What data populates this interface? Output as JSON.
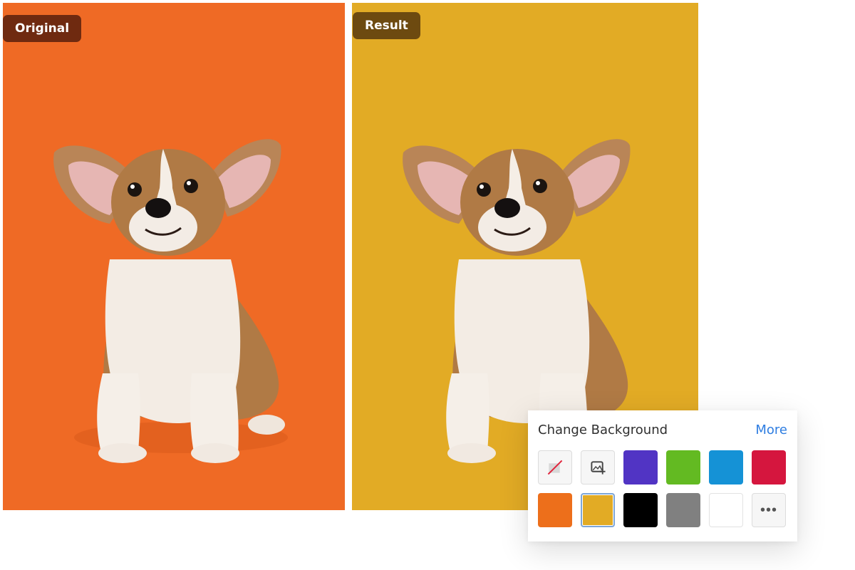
{
  "original": {
    "label": "Original",
    "background_color": "#ef6a25"
  },
  "result": {
    "label": "Result",
    "background_color": "#e2ab25"
  },
  "change_background": {
    "title": "Change Background",
    "more_label": "More",
    "row1": [
      {
        "kind": "transparent",
        "icon": "no-background-icon"
      },
      {
        "kind": "image",
        "icon": "add-image-icon"
      },
      {
        "kind": "color",
        "color": "#5134c4"
      },
      {
        "kind": "color",
        "color": "#63ba22"
      },
      {
        "kind": "color",
        "color": "#1592d6"
      },
      {
        "kind": "color",
        "color": "#d5163e"
      }
    ],
    "row2": [
      {
        "kind": "color",
        "color": "#ed6f1b"
      },
      {
        "kind": "color",
        "color": "#e2ab25",
        "selected": true
      },
      {
        "kind": "color",
        "color": "#000000"
      },
      {
        "kind": "color",
        "color": "#808080"
      },
      {
        "kind": "color",
        "color": "#ffffff"
      },
      {
        "kind": "more",
        "icon": "more-dots-icon",
        "glyph": "•••"
      }
    ]
  }
}
